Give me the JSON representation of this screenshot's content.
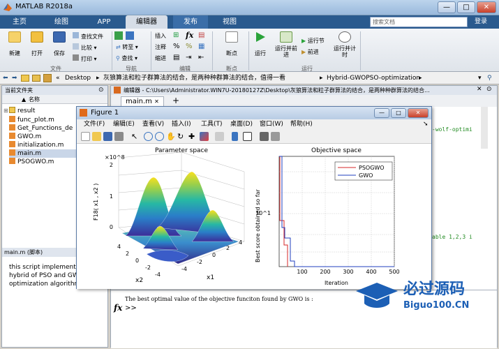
{
  "window": {
    "title": "MATLAB R2018a",
    "btn_min": "—",
    "btn_max": "□",
    "btn_close": "✕"
  },
  "ribbon_tabs": [
    "主页",
    "绘图",
    "APP",
    "编辑器",
    "发布",
    "视图"
  ],
  "search": {
    "placeholder": "搜索文档"
  },
  "login": "登录",
  "ribbon": {
    "new": "新建",
    "open": "打开",
    "save": "保存",
    "find_files": "查找文件",
    "compare": "比较",
    "print": "打印",
    "goto": "转至",
    "find": "查找",
    "insert": "插入",
    "comment": "注释",
    "indent": "缩进",
    "breakpoints": "断点",
    "run": "运行",
    "run_advance": "运行并前进",
    "run_section": "运行节",
    "advance": "前进",
    "run_time": "运行并计时",
    "sec_file": "文件",
    "sec_nav": "导航",
    "sec_edit": "编辑",
    "sec_bp": "断点",
    "sec_run": "运行"
  },
  "address": {
    "path": [
      "Desktop",
      "灰狼算法和粒子群算法的结合，是两种种群算法的结合，值得一看",
      "Hybrid-GWOPSO-optimization"
    ]
  },
  "current_folder": {
    "header": "当前文件夹",
    "col_name": "名称",
    "items": [
      "result",
      "func_plot.m",
      "Get_Functions_de",
      "GWO.m",
      "initialization.m",
      "main.m",
      "PSOGWO.m"
    ]
  },
  "details": {
    "header": "main.m  (脚本)",
    "text": [
      "this script implements",
      "hybrid of PSO and GW",
      "optimization algorithm"
    ]
  },
  "editor": {
    "header": "编辑器 - C:\\Users\\Administrator.WIN7U-20180127Z\\Desktop\\灰狼算法和粒子群算法的结合，是两种种群算法的结合...",
    "tab": "main.m",
    "plus": "+",
    "code_right1": "-wolf-optimi",
    "code_right2": "able 1,2,3 i"
  },
  "command_window": {
    "line1": "The best optimal value of the objective funciton found by GWO is : ",
    "fx": "fx",
    "prompt": ">>"
  },
  "figure": {
    "title": "Figure 1",
    "btn_min": "—",
    "btn_max": "□",
    "btn_close": "✕",
    "menu": [
      "文件(F)",
      "编辑(E)",
      "查看(V)",
      "插入(I)",
      "工具(T)",
      "桌面(D)",
      "窗口(W)",
      "帮助(H)"
    ]
  },
  "chart_data": [
    {
      "type": "surface",
      "title": "Parameter space",
      "xlabel": "x1",
      "ylabel": "x2",
      "zlabel": "F18( x1 , x2 )",
      "zscale_label": "×10^8",
      "ztick_labels": [
        "0",
        "1",
        "2"
      ],
      "xtick_labels": [
        "-4",
        "-2",
        "0",
        "2",
        "4"
      ],
      "ytick_labels": [
        "4",
        "2",
        "0",
        "-2",
        "-4"
      ]
    },
    {
      "type": "line",
      "title": "Objective space",
      "xlabel": "Iteration",
      "ylabel": "Best score obtained so far",
      "yscale": "log",
      "ytick_labels": [
        "10^1"
      ],
      "xtick_labels": [
        "100",
        "200",
        "300",
        "400",
        "500"
      ],
      "xlim": [
        0,
        500
      ],
      "grid": true,
      "legend": "top-right",
      "series": [
        {
          "name": "PSOGWO",
          "color": "#d62728"
        },
        {
          "name": "GWO",
          "color": "#1f3fbf"
        }
      ]
    }
  ],
  "watermark": {
    "cn": "必过源码",
    "en": "Biguo100.CN"
  }
}
